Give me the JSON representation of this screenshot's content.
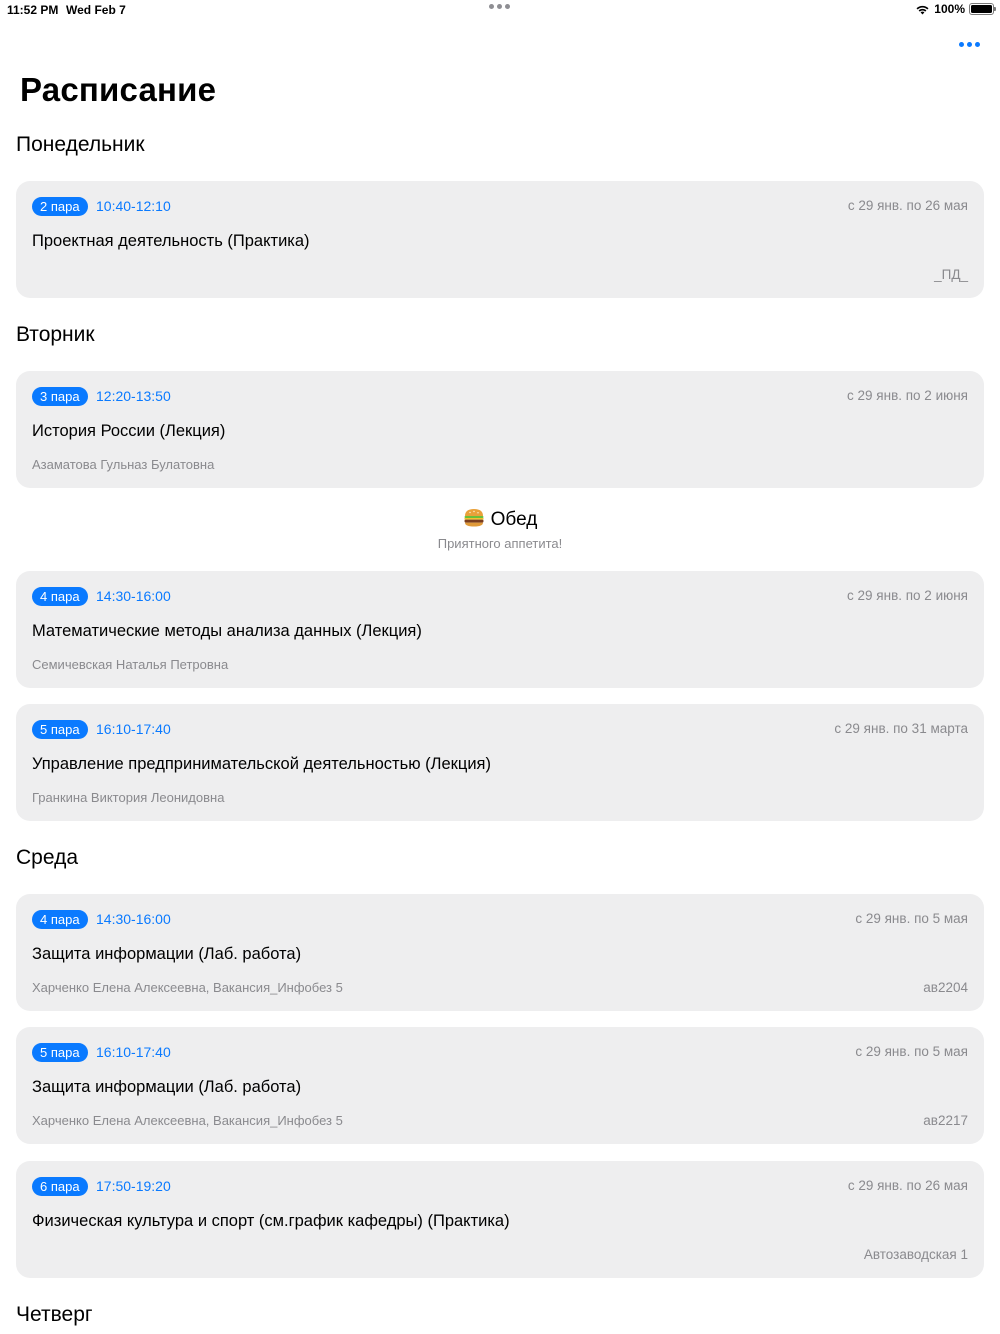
{
  "status_bar": {
    "time": "11:52 PM",
    "date": "Wed Feb 7",
    "battery": "100%"
  },
  "icons": {
    "more": "ellipsis-icon",
    "wifi": "wifi-icon",
    "battery": "battery-icon",
    "lunch": "burger-icon"
  },
  "colors": {
    "accent": "#0a7aff",
    "card_bg": "#eeeeef",
    "secondary_text": "#8a8a8e"
  },
  "title": "Расписание",
  "days": {
    "monday": "Понедельник",
    "tuesday": "Вторник",
    "wednesday": "Среда",
    "thursday": "Четверг"
  },
  "lunch": {
    "title": "Обед",
    "subtitle": "Приятного аппетита!"
  },
  "lessons": [
    {
      "badge": "2 пара",
      "time": "10:40-12:10",
      "range": "с 29 янв. по 26 мая",
      "subject": "Проектная деятельность (Практика)",
      "teacher": "",
      "room": "_ПД_"
    },
    {
      "badge": "3 пара",
      "time": "12:20-13:50",
      "range": "с 29 янв. по 2 июня",
      "subject": "История России (Лекция)",
      "teacher": "Азаматова Гульназ Булатовна",
      "room": ""
    },
    {
      "badge": "4 пара",
      "time": "14:30-16:00",
      "range": "с 29 янв. по 2 июня",
      "subject": "Математические методы анализа данных (Лекция)",
      "teacher": "Семичевская Наталья Петровна",
      "room": ""
    },
    {
      "badge": "5 пара",
      "time": "16:10-17:40",
      "range": "с 29 янв. по 31 марта",
      "subject": "Управление предпринимательской деятельностью (Лекция)",
      "teacher": "Гранкина Виктория Леонидовна",
      "room": ""
    },
    {
      "badge": "4 пара",
      "time": "14:30-16:00",
      "range": "с 29 янв. по 5 мая",
      "subject": "Защита информации (Лаб. работа)",
      "teacher": "Харченко Елена Алексеевна, Вакансия_Инфобез 5",
      "room": "ав2204"
    },
    {
      "badge": "5 пара",
      "time": "16:10-17:40",
      "range": "с 29 янв. по 5 мая",
      "subject": "Защита информации (Лаб. работа)",
      "teacher": "Харченко Елена Алексеевна, Вакансия_Инфобез 5",
      "room": "ав2217"
    },
    {
      "badge": "6 пара",
      "time": "17:50-19:20",
      "range": "с 29 янв. по 26 мая",
      "subject": "Физическая культура и спорт (см.график кафедры) (Практика)",
      "teacher": "",
      "room": "Автозаводская 1"
    }
  ]
}
